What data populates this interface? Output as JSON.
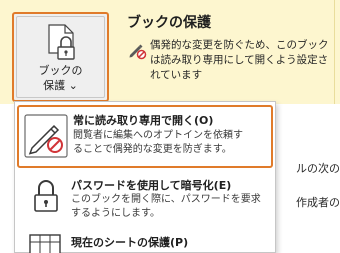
{
  "protect_button": {
    "line1": "ブックの",
    "line2": "保護",
    "chevron": "⌄"
  },
  "panel": {
    "title": "ブックの保護",
    "description_lines": [
      "偶発的な変更を防ぐため、このブック",
      "は読み取り専用にして開くよう設定さ",
      "れています"
    ]
  },
  "menu": {
    "items": [
      {
        "title": "常に読み取り専用で開く(O)",
        "desc_lines": [
          "閲覧者に編集へのオプトインを依頼す",
          "ることで偶発的な変更を防ぎます。"
        ],
        "icon": "pencil-no-edit-icon"
      },
      {
        "title": "パスワードを使用して暗号化(E)",
        "desc_lines": [
          "このブックを開く際に、パスワードを要求",
          "するようにします。"
        ],
        "icon": "lock-key-icon"
      },
      {
        "title": "現在のシートの保護(P)",
        "desc_lines": [],
        "icon": "sheet-lock-icon"
      }
    ]
  },
  "background_text": {
    "line1": "ルの次の項",
    "line2": "作成者の名"
  },
  "colors": {
    "accent_orange": "#e07b2a",
    "panel_yellow": "#fdf6cf"
  }
}
